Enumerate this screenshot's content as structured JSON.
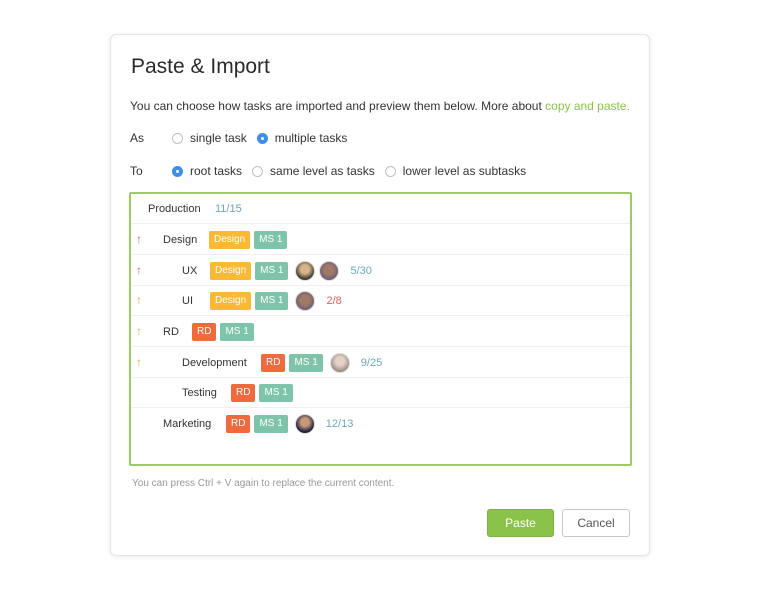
{
  "dialog": {
    "title": "Paste & Import",
    "intro_text": "You can choose how tasks are imported and preview them below. More about ",
    "intro_link": "copy and paste.",
    "as_label": "As",
    "as_options": [
      {
        "label": "single task",
        "selected": false
      },
      {
        "label": "multiple tasks",
        "selected": true
      }
    ],
    "to_label": "To",
    "to_options": [
      {
        "label": "root tasks",
        "selected": true
      },
      {
        "label": "same level as tasks",
        "selected": false
      },
      {
        "label": "lower level as subtasks",
        "selected": false
      }
    ],
    "hint": "You can press Ctrl + V again to replace the current content.",
    "paste_label": "Paste",
    "cancel_label": "Cancel"
  },
  "colors": {
    "accent_green": "#8bc34a",
    "tag_design": "#f9b934",
    "tag_ms": "#7ec4aa",
    "tag_rd": "#f06a3e",
    "progress_blue": "#6aa8b8",
    "progress_red": "#e85b5b",
    "arrow_red": "#e85b5b",
    "arrow_orange": "#f5a623"
  },
  "tasks": [
    {
      "name": "Production",
      "progress": "11/15"
    },
    {
      "name": "Design",
      "tags": [
        "Design",
        "MS 1"
      ]
    },
    {
      "name": "UX",
      "tags": [
        "Design",
        "MS 1"
      ],
      "progress": "5/30"
    },
    {
      "name": "UI",
      "tags": [
        "Design",
        "MS 1"
      ],
      "progress": "2/8"
    },
    {
      "name": "RD",
      "tags": [
        "RD",
        "MS 1"
      ]
    },
    {
      "name": "Development",
      "tags": [
        "RD",
        "MS 1"
      ],
      "progress": "9/25"
    },
    {
      "name": "Testing",
      "tags": [
        "RD",
        "MS 1"
      ]
    },
    {
      "name": "Marketing",
      "tags": [
        "RD",
        "MS 1"
      ],
      "progress": "12/13"
    }
  ]
}
